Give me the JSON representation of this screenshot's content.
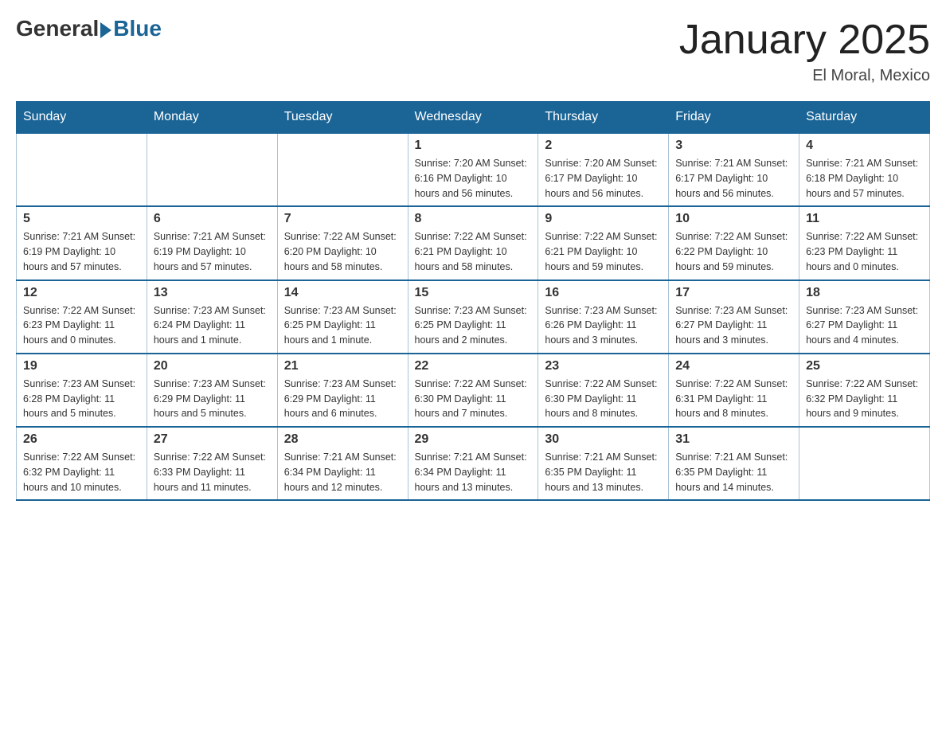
{
  "header": {
    "logo_general": "General",
    "logo_blue": "Blue",
    "title": "January 2025",
    "location": "El Moral, Mexico"
  },
  "calendar": {
    "days_of_week": [
      "Sunday",
      "Monday",
      "Tuesday",
      "Wednesday",
      "Thursday",
      "Friday",
      "Saturday"
    ],
    "weeks": [
      [
        {
          "day": "",
          "info": ""
        },
        {
          "day": "",
          "info": ""
        },
        {
          "day": "",
          "info": ""
        },
        {
          "day": "1",
          "info": "Sunrise: 7:20 AM\nSunset: 6:16 PM\nDaylight: 10 hours\nand 56 minutes."
        },
        {
          "day": "2",
          "info": "Sunrise: 7:20 AM\nSunset: 6:17 PM\nDaylight: 10 hours\nand 56 minutes."
        },
        {
          "day": "3",
          "info": "Sunrise: 7:21 AM\nSunset: 6:17 PM\nDaylight: 10 hours\nand 56 minutes."
        },
        {
          "day": "4",
          "info": "Sunrise: 7:21 AM\nSunset: 6:18 PM\nDaylight: 10 hours\nand 57 minutes."
        }
      ],
      [
        {
          "day": "5",
          "info": "Sunrise: 7:21 AM\nSunset: 6:19 PM\nDaylight: 10 hours\nand 57 minutes."
        },
        {
          "day": "6",
          "info": "Sunrise: 7:21 AM\nSunset: 6:19 PM\nDaylight: 10 hours\nand 57 minutes."
        },
        {
          "day": "7",
          "info": "Sunrise: 7:22 AM\nSunset: 6:20 PM\nDaylight: 10 hours\nand 58 minutes."
        },
        {
          "day": "8",
          "info": "Sunrise: 7:22 AM\nSunset: 6:21 PM\nDaylight: 10 hours\nand 58 minutes."
        },
        {
          "day": "9",
          "info": "Sunrise: 7:22 AM\nSunset: 6:21 PM\nDaylight: 10 hours\nand 59 minutes."
        },
        {
          "day": "10",
          "info": "Sunrise: 7:22 AM\nSunset: 6:22 PM\nDaylight: 10 hours\nand 59 minutes."
        },
        {
          "day": "11",
          "info": "Sunrise: 7:22 AM\nSunset: 6:23 PM\nDaylight: 11 hours\nand 0 minutes."
        }
      ],
      [
        {
          "day": "12",
          "info": "Sunrise: 7:22 AM\nSunset: 6:23 PM\nDaylight: 11 hours\nand 0 minutes."
        },
        {
          "day": "13",
          "info": "Sunrise: 7:23 AM\nSunset: 6:24 PM\nDaylight: 11 hours\nand 1 minute."
        },
        {
          "day": "14",
          "info": "Sunrise: 7:23 AM\nSunset: 6:25 PM\nDaylight: 11 hours\nand 1 minute."
        },
        {
          "day": "15",
          "info": "Sunrise: 7:23 AM\nSunset: 6:25 PM\nDaylight: 11 hours\nand 2 minutes."
        },
        {
          "day": "16",
          "info": "Sunrise: 7:23 AM\nSunset: 6:26 PM\nDaylight: 11 hours\nand 3 minutes."
        },
        {
          "day": "17",
          "info": "Sunrise: 7:23 AM\nSunset: 6:27 PM\nDaylight: 11 hours\nand 3 minutes."
        },
        {
          "day": "18",
          "info": "Sunrise: 7:23 AM\nSunset: 6:27 PM\nDaylight: 11 hours\nand 4 minutes."
        }
      ],
      [
        {
          "day": "19",
          "info": "Sunrise: 7:23 AM\nSunset: 6:28 PM\nDaylight: 11 hours\nand 5 minutes."
        },
        {
          "day": "20",
          "info": "Sunrise: 7:23 AM\nSunset: 6:29 PM\nDaylight: 11 hours\nand 5 minutes."
        },
        {
          "day": "21",
          "info": "Sunrise: 7:23 AM\nSunset: 6:29 PM\nDaylight: 11 hours\nand 6 minutes."
        },
        {
          "day": "22",
          "info": "Sunrise: 7:22 AM\nSunset: 6:30 PM\nDaylight: 11 hours\nand 7 minutes."
        },
        {
          "day": "23",
          "info": "Sunrise: 7:22 AM\nSunset: 6:30 PM\nDaylight: 11 hours\nand 8 minutes."
        },
        {
          "day": "24",
          "info": "Sunrise: 7:22 AM\nSunset: 6:31 PM\nDaylight: 11 hours\nand 8 minutes."
        },
        {
          "day": "25",
          "info": "Sunrise: 7:22 AM\nSunset: 6:32 PM\nDaylight: 11 hours\nand 9 minutes."
        }
      ],
      [
        {
          "day": "26",
          "info": "Sunrise: 7:22 AM\nSunset: 6:32 PM\nDaylight: 11 hours\nand 10 minutes."
        },
        {
          "day": "27",
          "info": "Sunrise: 7:22 AM\nSunset: 6:33 PM\nDaylight: 11 hours\nand 11 minutes."
        },
        {
          "day": "28",
          "info": "Sunrise: 7:21 AM\nSunset: 6:34 PM\nDaylight: 11 hours\nand 12 minutes."
        },
        {
          "day": "29",
          "info": "Sunrise: 7:21 AM\nSunset: 6:34 PM\nDaylight: 11 hours\nand 13 minutes."
        },
        {
          "day": "30",
          "info": "Sunrise: 7:21 AM\nSunset: 6:35 PM\nDaylight: 11 hours\nand 13 minutes."
        },
        {
          "day": "31",
          "info": "Sunrise: 7:21 AM\nSunset: 6:35 PM\nDaylight: 11 hours\nand 14 minutes."
        },
        {
          "day": "",
          "info": ""
        }
      ]
    ]
  }
}
